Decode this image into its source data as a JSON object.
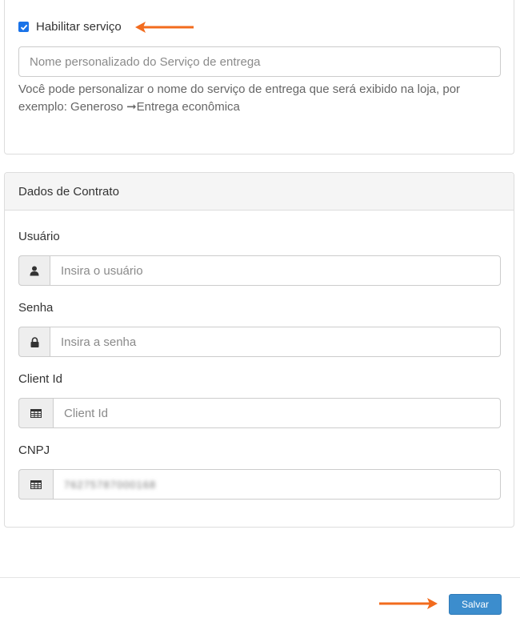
{
  "service": {
    "enable_label": "Habilitar serviço",
    "enabled": true,
    "name_placeholder": "Nome personalizado do Serviço de entrega",
    "help_text": "Você pode personalizar o nome do serviço de entrega que será exibido na loja, por exemplo: Generoso ➞Entrega econômica"
  },
  "contract": {
    "title": "Dados de Contrato",
    "user_label": "Usuário",
    "user_placeholder": "Insira o usuário",
    "password_label": "Senha",
    "password_placeholder": "Insira a senha",
    "client_id_label": "Client Id",
    "client_id_placeholder": "Client Id",
    "cnpj_label": "CNPJ",
    "cnpj_value": "76275787000168"
  },
  "footer": {
    "save_label": "Salvar"
  },
  "icons": {
    "user": "user-icon",
    "lock": "lock-icon",
    "table": "table-icon",
    "arrow": "arrow-left-icon",
    "arrow_right": "arrow-right-icon"
  },
  "colors": {
    "accent": "#3c8dcd",
    "checkbox": "#1a73e8",
    "annotation_arrow": "#f26b1d"
  }
}
